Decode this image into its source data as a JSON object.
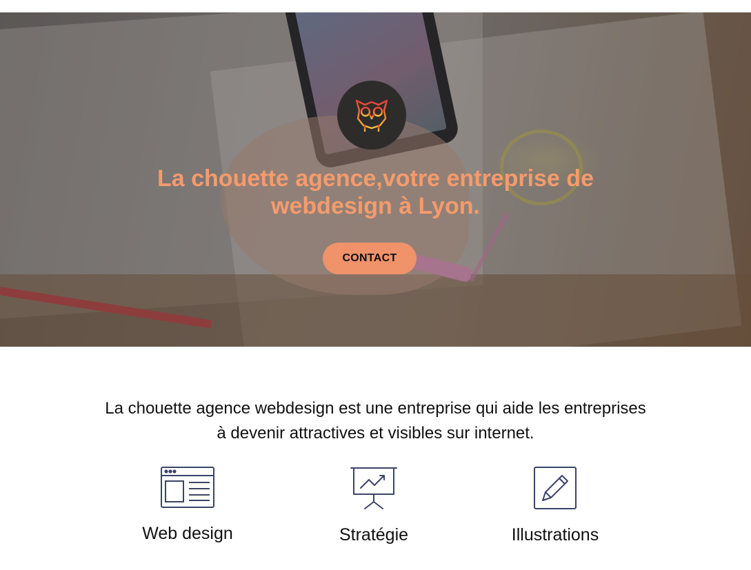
{
  "hero": {
    "title": "La chouette agence,votre entreprise de webdesign à Lyon.",
    "title_color": "#f59b6c",
    "contact_label": "CONTACT",
    "contact_color": "#f0926a",
    "logo_icon": "owl-icon"
  },
  "intro": {
    "text": "La chouette agence webdesign est une entreprise qui aide les entreprises à devenir attractives et visibles sur internet."
  },
  "services": [
    {
      "label": "Web design",
      "icon": "web-layout-icon"
    },
    {
      "label": "Stratégie",
      "icon": "presentation-chart-icon"
    },
    {
      "label": "Illustrations",
      "icon": "pencil-edit-icon"
    }
  ],
  "icon_color": "#3a4466"
}
